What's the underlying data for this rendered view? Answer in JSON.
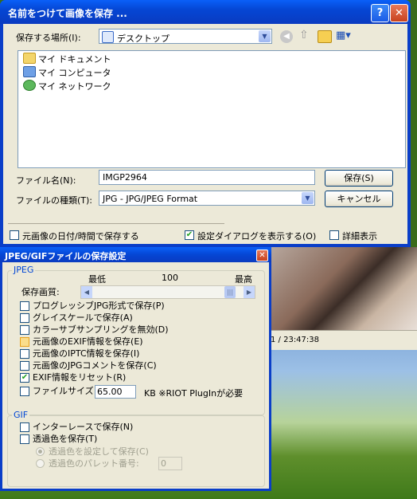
{
  "viewer": {
    "status_text": "1 / 23:47:38"
  },
  "save_dialog": {
    "title": "名前をつけて画像を保存 ...",
    "help_label": "?",
    "close_label": "✕",
    "location_label": "保存する場所(I):",
    "location_value": "デスクトップ",
    "file_list": [
      {
        "label": "マイ ドキュメント",
        "icon": "documents-folder-icon"
      },
      {
        "label": "マイ コンピュータ",
        "icon": "computer-icon"
      },
      {
        "label": "マイ ネットワーク",
        "icon": "network-icon"
      }
    ],
    "filename_label": "ファイル名(N):",
    "filename_value": "IMGP2964",
    "filetype_label": "ファイルの種類(T):",
    "filetype_value": "JPG - JPG/JPEG Format",
    "save_button": "保存(S)",
    "cancel_button": "キャンセル",
    "keep_datetime": {
      "label": "元画像の日付/時間で保存する",
      "checked": false
    },
    "show_settings": {
      "label": "設定ダイアログを表示する(O)",
      "checked": true
    },
    "details": {
      "label": "詳細表示",
      "checked": false
    }
  },
  "jpeg_dialog": {
    "title": "JPEG/GIFファイルの保存設定",
    "close_label": "✕",
    "jpeg_group": "JPEG",
    "quality_low": "最低",
    "quality_value": "100",
    "quality_high": "最高",
    "quality_label": "保存画質:",
    "quality_level": 1.0,
    "options": [
      {
        "label": "プログレッシブJPG形式で保存(P)",
        "checked": false
      },
      {
        "label": "グレイスケールで保存(A)",
        "checked": false
      },
      {
        "label": "カラーサブサンプリングを無効(D)",
        "checked": false
      },
      {
        "label": "元画像のEXIF情報を保存(E)",
        "checked": false
      },
      {
        "label": "元画像のIPTC情報を保存(I)",
        "checked": false
      },
      {
        "label": "元画像のJPGコメントを保存(C)",
        "checked": false
      },
      {
        "label": "EXIF情報をリセット(R)",
        "checked": true
      }
    ],
    "filesize_label": "ファイルサイズ",
    "filesize_value": "65.00",
    "filesize_note": "KB ※RIOT PlugInが必要",
    "gif_group": "GIF",
    "interlace_label": "インターレースで保存(N)",
    "transparent_label": "透過色を保存(T)",
    "transparent_setting_label": "透過色を設定して保存(C)",
    "transparent_palette_label": "透過色のパレット番号:",
    "palette_value": "0"
  }
}
